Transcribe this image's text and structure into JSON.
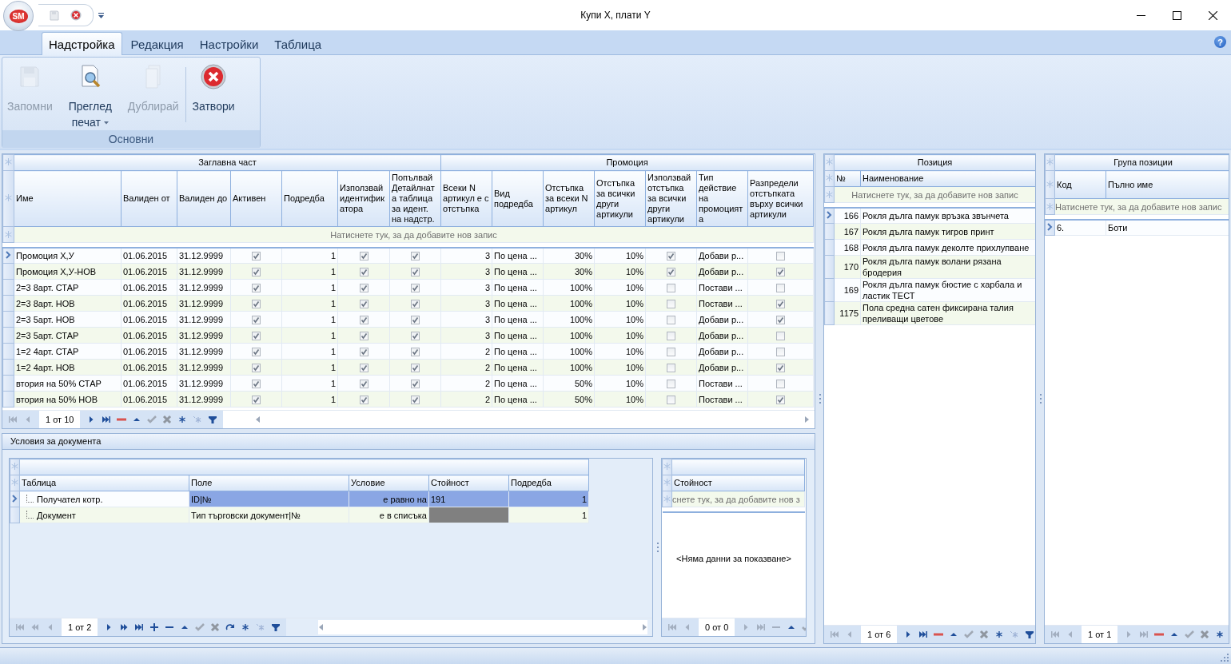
{
  "window": {
    "logo": "SM",
    "title": "Купи X, плати Y"
  },
  "ribbon": {
    "tabs": [
      {
        "label": "Надстройка",
        "selected": true
      },
      {
        "label": "Редакция",
        "selected": false
      },
      {
        "label": "Настройки",
        "selected": false
      },
      {
        "label": "Таблица",
        "selected": false
      }
    ],
    "help": "?",
    "groups": [
      {
        "label": "Основни",
        "buttons": [
          {
            "label": "Запомни",
            "kind": "save",
            "disabled": true,
            "dropdown": false
          },
          {
            "label": "Преглед печат",
            "kind": "preview",
            "disabled": false,
            "dropdown": true
          },
          {
            "label": "Дублирай",
            "kind": "duplicate",
            "disabled": true,
            "dropdown": false
          },
          {
            "label": "Затвори",
            "kind": "close",
            "disabled": false,
            "dropdown": false
          }
        ]
      }
    ]
  },
  "main_grid": {
    "bands": [
      {
        "label": "Заглавна част",
        "columns": [
          {
            "label": "Име",
            "kind": "text"
          },
          {
            "label": "Валиден от",
            "kind": "text"
          },
          {
            "label": "Валиден до",
            "kind": "text"
          },
          {
            "label": "Активен",
            "kind": "check"
          },
          {
            "label": "Подредба",
            "kind": "number"
          },
          {
            "label": "Използвай идентификатора",
            "kind": "check"
          },
          {
            "label": "Попълвай Детайлната таблица за идент. на надстр.",
            "kind": "check"
          }
        ]
      },
      {
        "label": "Промоция",
        "columns": [
          {
            "label": "Всеки N артикул е с отстъпка",
            "kind": "number"
          },
          {
            "label": "Вид подредба",
            "kind": "text"
          },
          {
            "label": "Отстъпка за всеки N артикул",
            "kind": "number"
          },
          {
            "label": "Отстъпка за всички други артикули",
            "kind": "number"
          },
          {
            "label": "Използвай отстъпка за всички други артикули",
            "kind": "check"
          },
          {
            "label": "Тип действие на промоцията",
            "kind": "text"
          },
          {
            "label": "Разпредели отстъпката върху всички артикули",
            "kind": "check"
          }
        ]
      }
    ],
    "prompt": "Натиснете тук, за да добавите нов запис",
    "rows": [
      {
        "selected": true,
        "cells": [
          "Промоция X,У",
          "01.06.2015",
          "31.12.9999",
          true,
          "1",
          true,
          true,
          "3",
          "По цена ...",
          "30%",
          "10%",
          true,
          "Добави р...",
          false
        ]
      },
      {
        "selected": false,
        "cells": [
          "Промоция X,У-НОВ",
          "01.06.2015",
          "31.12.9999",
          true,
          "1",
          true,
          true,
          "3",
          "По цена ...",
          "30%",
          "10%",
          true,
          "Добави р...",
          true
        ]
      },
      {
        "selected": false,
        "cells": [
          "2=3 8арт. СТАР",
          "01.06.2015",
          "31.12.9999",
          true,
          "1",
          true,
          true,
          "3",
          "По цена ...",
          "100%",
          "10%",
          false,
          "Постави ...",
          false
        ]
      },
      {
        "selected": false,
        "cells": [
          "2=3 8арт. НОВ",
          "01.06.2015",
          "31.12.9999",
          true,
          "1",
          true,
          true,
          "3",
          "По цена ...",
          "100%",
          "10%",
          false,
          "Постави ...",
          true
        ]
      },
      {
        "selected": false,
        "cells": [
          "2=3 5арт. НОВ",
          "01.06.2015",
          "31.12.9999",
          true,
          "1",
          true,
          true,
          "3",
          "По цена ...",
          "100%",
          "10%",
          false,
          "Добави р...",
          true
        ]
      },
      {
        "selected": false,
        "cells": [
          "2=3 5арт. СТАР",
          "01.06.2015",
          "31.12.9999",
          true,
          "1",
          true,
          true,
          "3",
          "По цена ...",
          "100%",
          "10%",
          false,
          "Добави р...",
          false
        ]
      },
      {
        "selected": false,
        "cells": [
          "1=2 4арт. СТАР",
          "01.06.2015",
          "31.12.9999",
          true,
          "1",
          true,
          true,
          "2",
          "По цена ...",
          "100%",
          "10%",
          false,
          "Добави р...",
          false
        ]
      },
      {
        "selected": false,
        "cells": [
          "1=2 4арт. НОВ",
          "01.06.2015",
          "31.12.9999",
          true,
          "1",
          true,
          true,
          "2",
          "По цена ...",
          "100%",
          "10%",
          false,
          "Добави р...",
          true
        ]
      },
      {
        "selected": false,
        "cells": [
          "втория на 50% СТАР",
          "01.06.2015",
          "31.12.9999",
          true,
          "1",
          true,
          true,
          "2",
          "По цена ...",
          "50%",
          "10%",
          false,
          "Постави ...",
          false
        ]
      },
      {
        "selected": false,
        "cells": [
          "втория на 50% НОВ",
          "01.06.2015",
          "31.12.9999",
          true,
          "1",
          true,
          true,
          "2",
          "По цена ...",
          "50%",
          "10%",
          false,
          "Постави ...",
          true
        ]
      }
    ],
    "pager": "1 от 10"
  },
  "conditions": {
    "title": "Условия за документа",
    "grid": {
      "columns": [
        "Таблица",
        "Поле",
        "Условие",
        "Стойност",
        "Подредба"
      ],
      "rows": [
        {
          "selected": true,
          "cells": [
            "Получател котр.",
            "ID|№",
            "е равно на",
            "191",
            "1"
          ]
        },
        {
          "selected": false,
          "cells": [
            "Документ",
            "Тип търговски документ|№",
            "е в списъка",
            null,
            "1"
          ]
        }
      ],
      "pager": "1 от 2"
    },
    "values": {
      "columns": [
        "Стойност"
      ],
      "prompt": "снете тук, за да добавите нов з",
      "empty_text": "<Няма данни за показване>",
      "pager": "0 от 0"
    }
  },
  "positions": {
    "band": "Позиция",
    "columns": [
      "№",
      "Наименование"
    ],
    "prompt": "Натиснете тук, за да добавите нов запис",
    "rows": [
      {
        "selected": true,
        "number": "166",
        "name": "Рокля дълга памук връзка звънчета"
      },
      {
        "selected": false,
        "number": "167",
        "name": "Рокля дълга памук тигров принт"
      },
      {
        "selected": false,
        "number": "168",
        "name": "Рокля дълга  памук деколте прихлупване"
      },
      {
        "selected": false,
        "number": "170",
        "name": "Рокля дълга памук волани рязана бродерия"
      },
      {
        "selected": false,
        "number": "169",
        "name": "Рокля дълга памук бюстие с харбала и ластик ТЕСТ"
      },
      {
        "selected": false,
        "number": "1175",
        "name": "Пола средна сатен фиксирана талия преливащи цветове"
      }
    ],
    "pager": "1 от 6"
  },
  "groups": {
    "band": "Група позиции",
    "columns": [
      "Код",
      "Пълно име"
    ],
    "prompt": "Натиснете тук, за да добавите нов запис",
    "rows": [
      {
        "selected": true,
        "code": "6.",
        "name": "Боти"
      }
    ],
    "pager": "1 от 1"
  }
}
